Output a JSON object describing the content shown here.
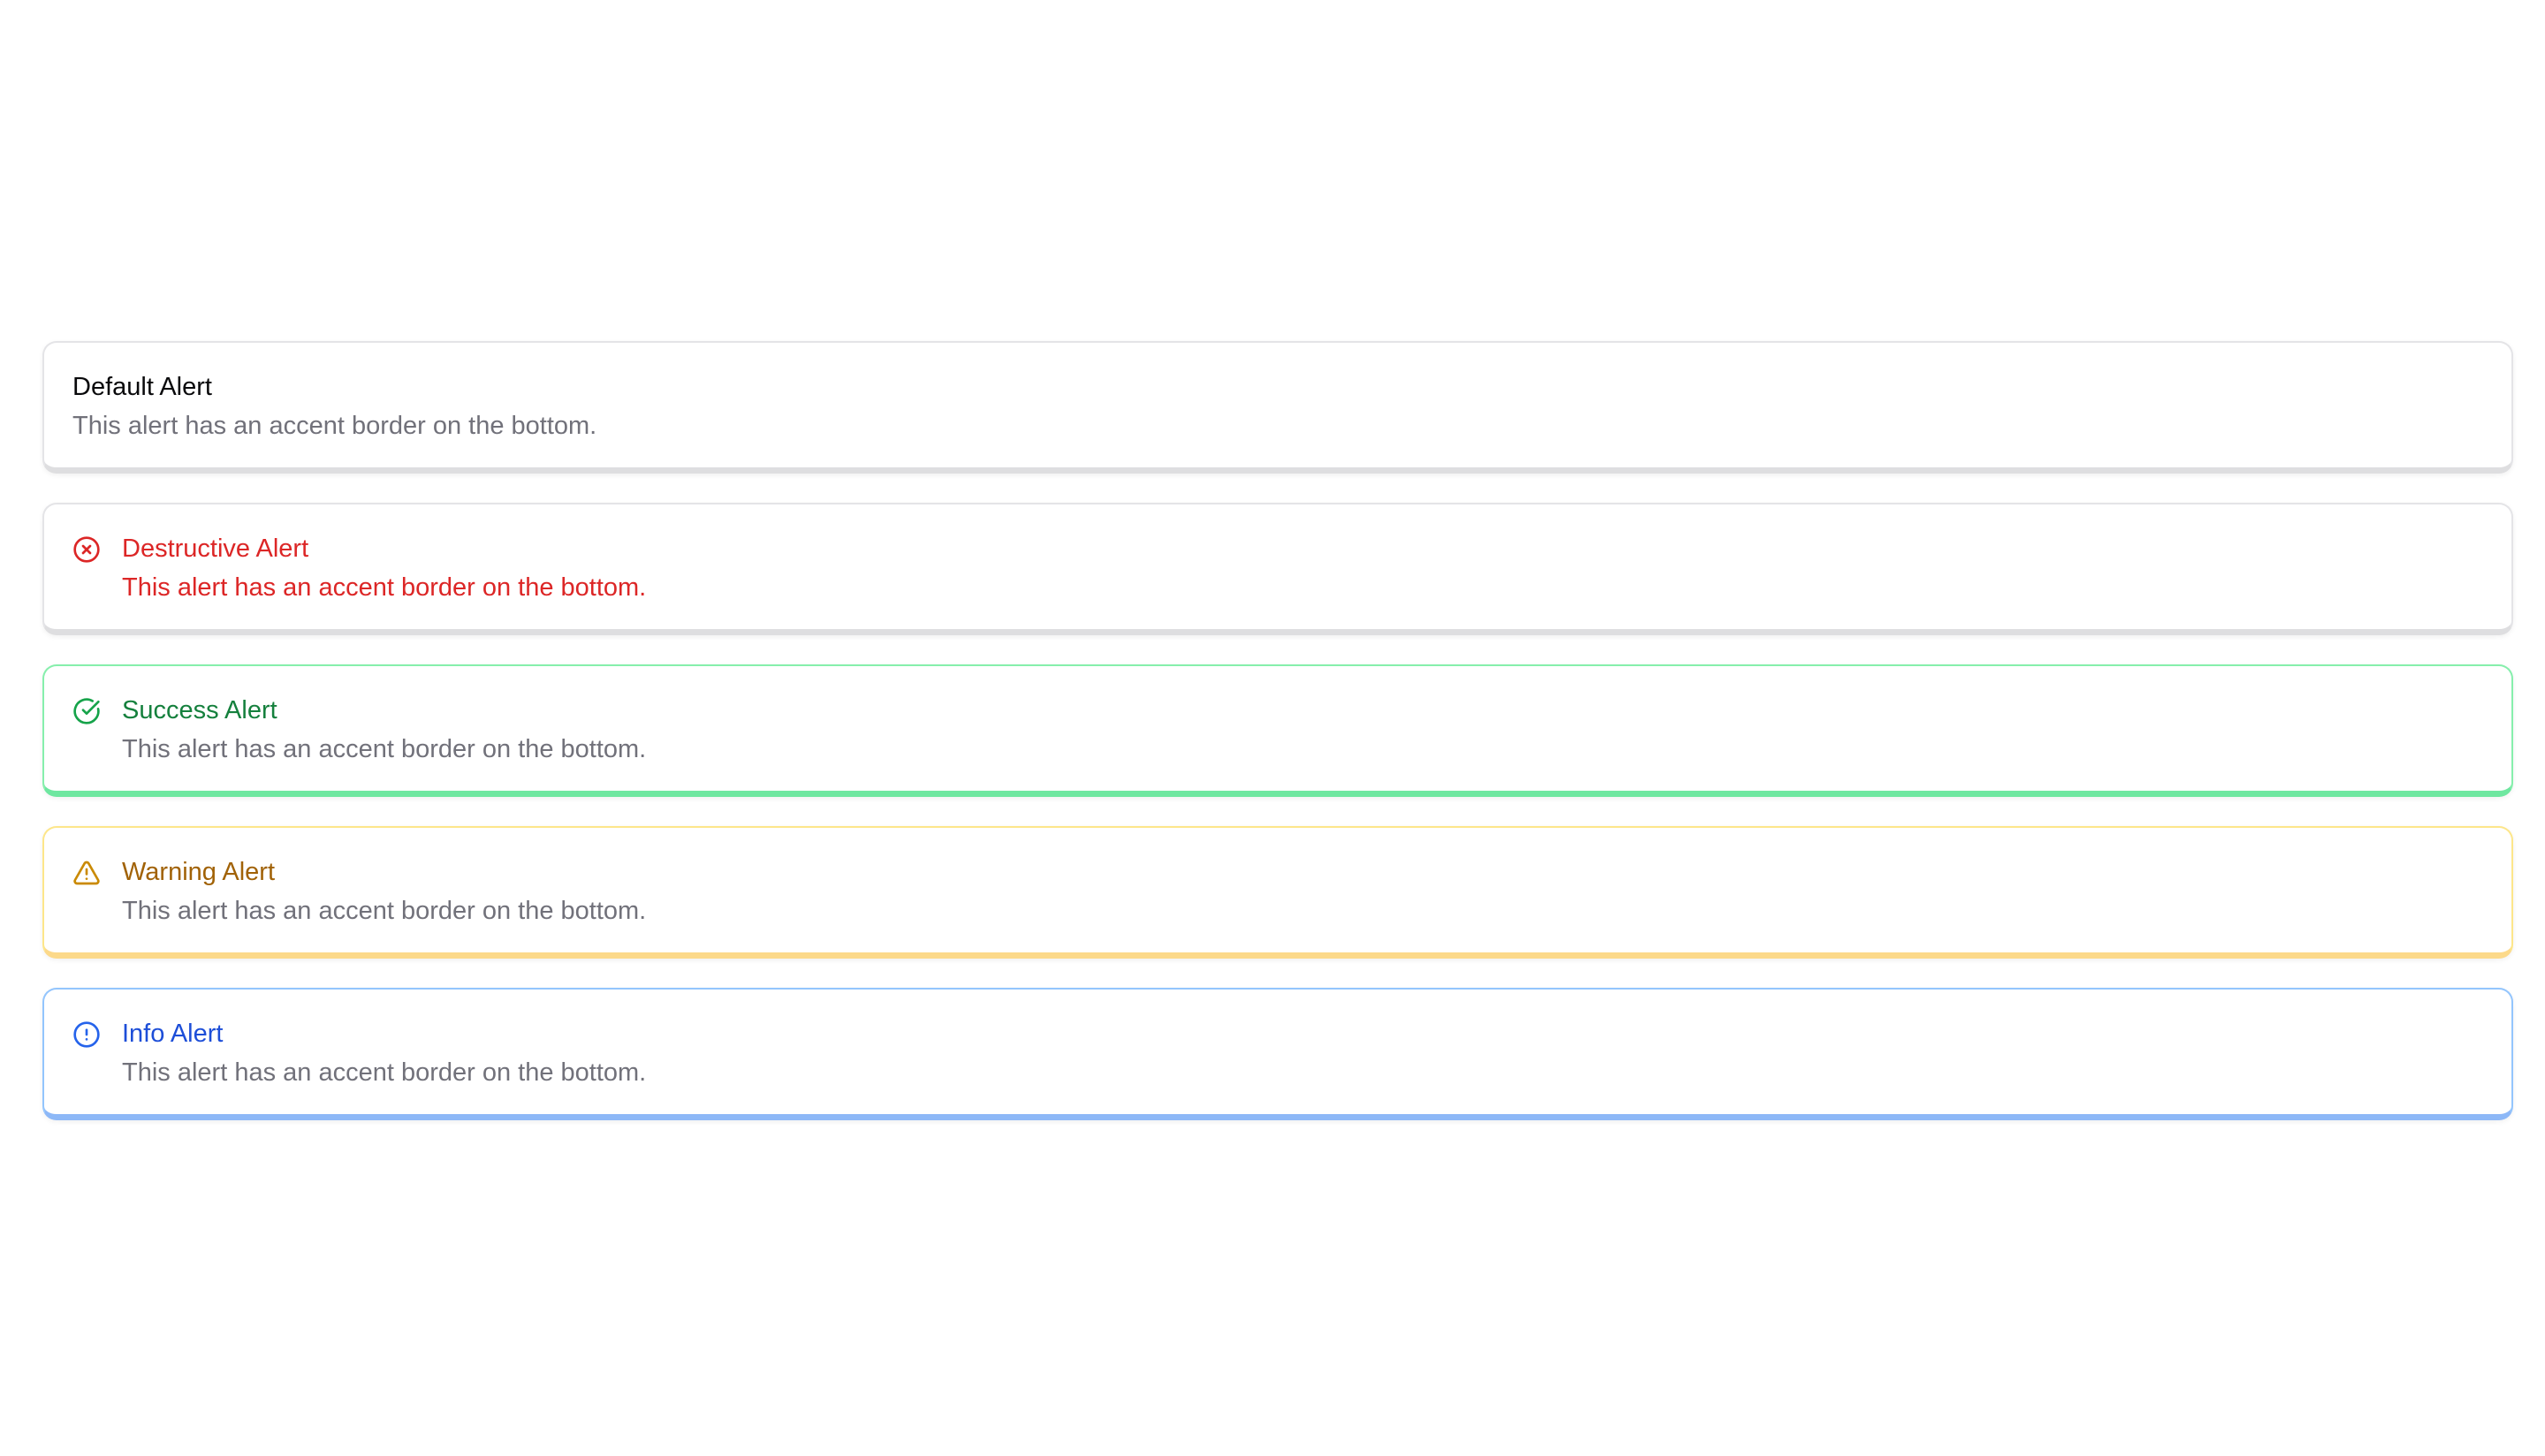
{
  "alerts": {
    "default": {
      "title": "Default Alert",
      "description": "This alert has an accent border on the bottom.",
      "accent_color": "#e4e4e7"
    },
    "destructive": {
      "title": "Destructive Alert",
      "description": "This alert has an accent border on the bottom.",
      "icon": "x-circle-icon",
      "accent_color": "#dc2626"
    },
    "success": {
      "title": "Success Alert",
      "description": "This alert has an accent border on the bottom.",
      "icon": "check-circle-icon",
      "accent_color": "#16a34a"
    },
    "warning": {
      "title": "Warning Alert",
      "description": "This alert has an accent border on the bottom.",
      "icon": "warning-triangle-icon",
      "accent_color": "#ca8a04"
    },
    "info": {
      "title": "Info Alert",
      "description": "This alert has an accent border on the bottom.",
      "icon": "info-circle-icon",
      "accent_color": "#2563eb"
    }
  }
}
